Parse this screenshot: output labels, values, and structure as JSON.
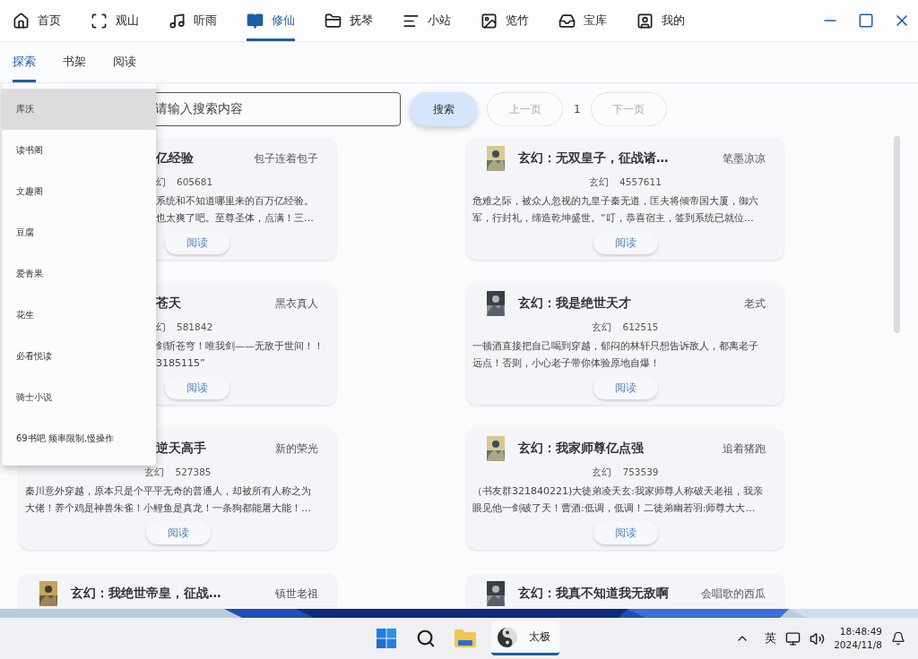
{
  "nav": {
    "tabs": [
      {
        "label": "首页",
        "selected": false
      },
      {
        "label": "观山",
        "selected": false
      },
      {
        "label": "听雨",
        "selected": false
      },
      {
        "label": "修仙",
        "selected": true
      },
      {
        "label": "抚琴",
        "selected": false
      },
      {
        "label": "小站",
        "selected": false
      },
      {
        "label": "览竹",
        "selected": false
      },
      {
        "label": "宝库",
        "selected": false
      },
      {
        "label": "我的",
        "selected": false
      }
    ]
  },
  "subtabs": [
    {
      "label": "探索",
      "selected": true
    },
    {
      "label": "书架",
      "selected": false
    },
    {
      "label": "阅读",
      "selected": false
    }
  ],
  "source_menu": {
    "items": [
      {
        "label": "库沃",
        "selected": true
      },
      {
        "label": "读书阁",
        "selected": false
      },
      {
        "label": "文趣阁",
        "selected": false
      },
      {
        "label": "豆腐",
        "selected": false
      },
      {
        "label": "爱青果",
        "selected": false
      },
      {
        "label": "花生",
        "selected": false
      },
      {
        "label": "必看悦读",
        "selected": false
      },
      {
        "label": "骑士小说",
        "selected": false
      },
      {
        "label": "69书吧 频率限制,慢操作",
        "selected": false
      }
    ]
  },
  "search": {
    "placeholder": "请输入搜索内容",
    "button": "搜索"
  },
  "pager": {
    "prev": {
      "label": "上一页",
      "disabled": true
    },
    "page": "1",
    "next": {
      "label": "下一页",
      "disabled": true
    }
  },
  "cards": [
    {
      "kind": "covered",
      "title": "亿经验",
      "author": "包子连着包子",
      "genre": "幻",
      "count": "605681",
      "desc": [
        "系统和不知道哪里来的百万亿经验。",
        "也太爽了吧。至尊圣体，点满！三…"
      ],
      "button": "阅读"
    },
    {
      "kind": "plain",
      "title": "玄幻：无双皇子，征战诸…",
      "author": "笔墨凉凉",
      "genre": "玄幻",
      "count": "4557611",
      "desc": [
        "危难之际，被众人忽视的九皇子秦无道，匡夫将倾帝国大厦，御六",
        "军，行封礼，缔造乾坤盛世。“叮，恭喜宿主，签到系统已就位…"
      ],
      "button": "阅读"
    },
    {
      "kind": "covered",
      "title": "苍天",
      "author": "黑衣真人",
      "genre": "幻",
      "count": "581842",
      "desc": [
        "剑斩苍穹！唯我剑——无敌于世间！！",
        "3185115”"
      ],
      "button": "阅读"
    },
    {
      "kind": "plain",
      "title": "玄幻：我是绝世天才",
      "author": "老式",
      "genre": "玄幻",
      "count": "612515",
      "desc": [
        "一顿酒直接把自己喝到穿越，郁闷的林轩只想告诉敌人，都离老子",
        "远点！否则，小心老子带你体验原地自爆！"
      ],
      "button": "阅读"
    },
    {
      "kind": "header_covered",
      "title": "逆天高手",
      "author": "新的荣光",
      "genre": "玄幻",
      "count": "527385",
      "desc": [
        "秦川意外穿越，原本只是个平平无奇的普通人，却被所有人称之为",
        "大佬！养个鸡是神兽朱雀！小鲤鱼是真龙！一条狗都能屠大能！…"
      ],
      "button": "阅读"
    },
    {
      "kind": "plain",
      "title": "玄幻：我家师尊亿点强",
      "author": "追着猪跑",
      "genre": "玄幻",
      "count": "753539",
      "desc": [
        "（书友群321840221)大徒弟凌天玄:我家师尊人称破天老祖，我亲",
        "眼见他一剑破了天！曹酒:低调，低调！二徒弟幽若羽:师尊大大…"
      ],
      "button": "阅读"
    },
    {
      "kind": "plain",
      "title": "玄幻：我绝世帝皇，征战…",
      "author": "镇世老祖"
    },
    {
      "kind": "plain",
      "title": "玄幻：我真不知道我无敌啊",
      "author": "会唱歌的西瓜"
    }
  ],
  "taskbar": {
    "app": {
      "label": "太极",
      "selected": true
    },
    "ime": "英",
    "time": "18:48:49",
    "date": "2024/11/8"
  }
}
